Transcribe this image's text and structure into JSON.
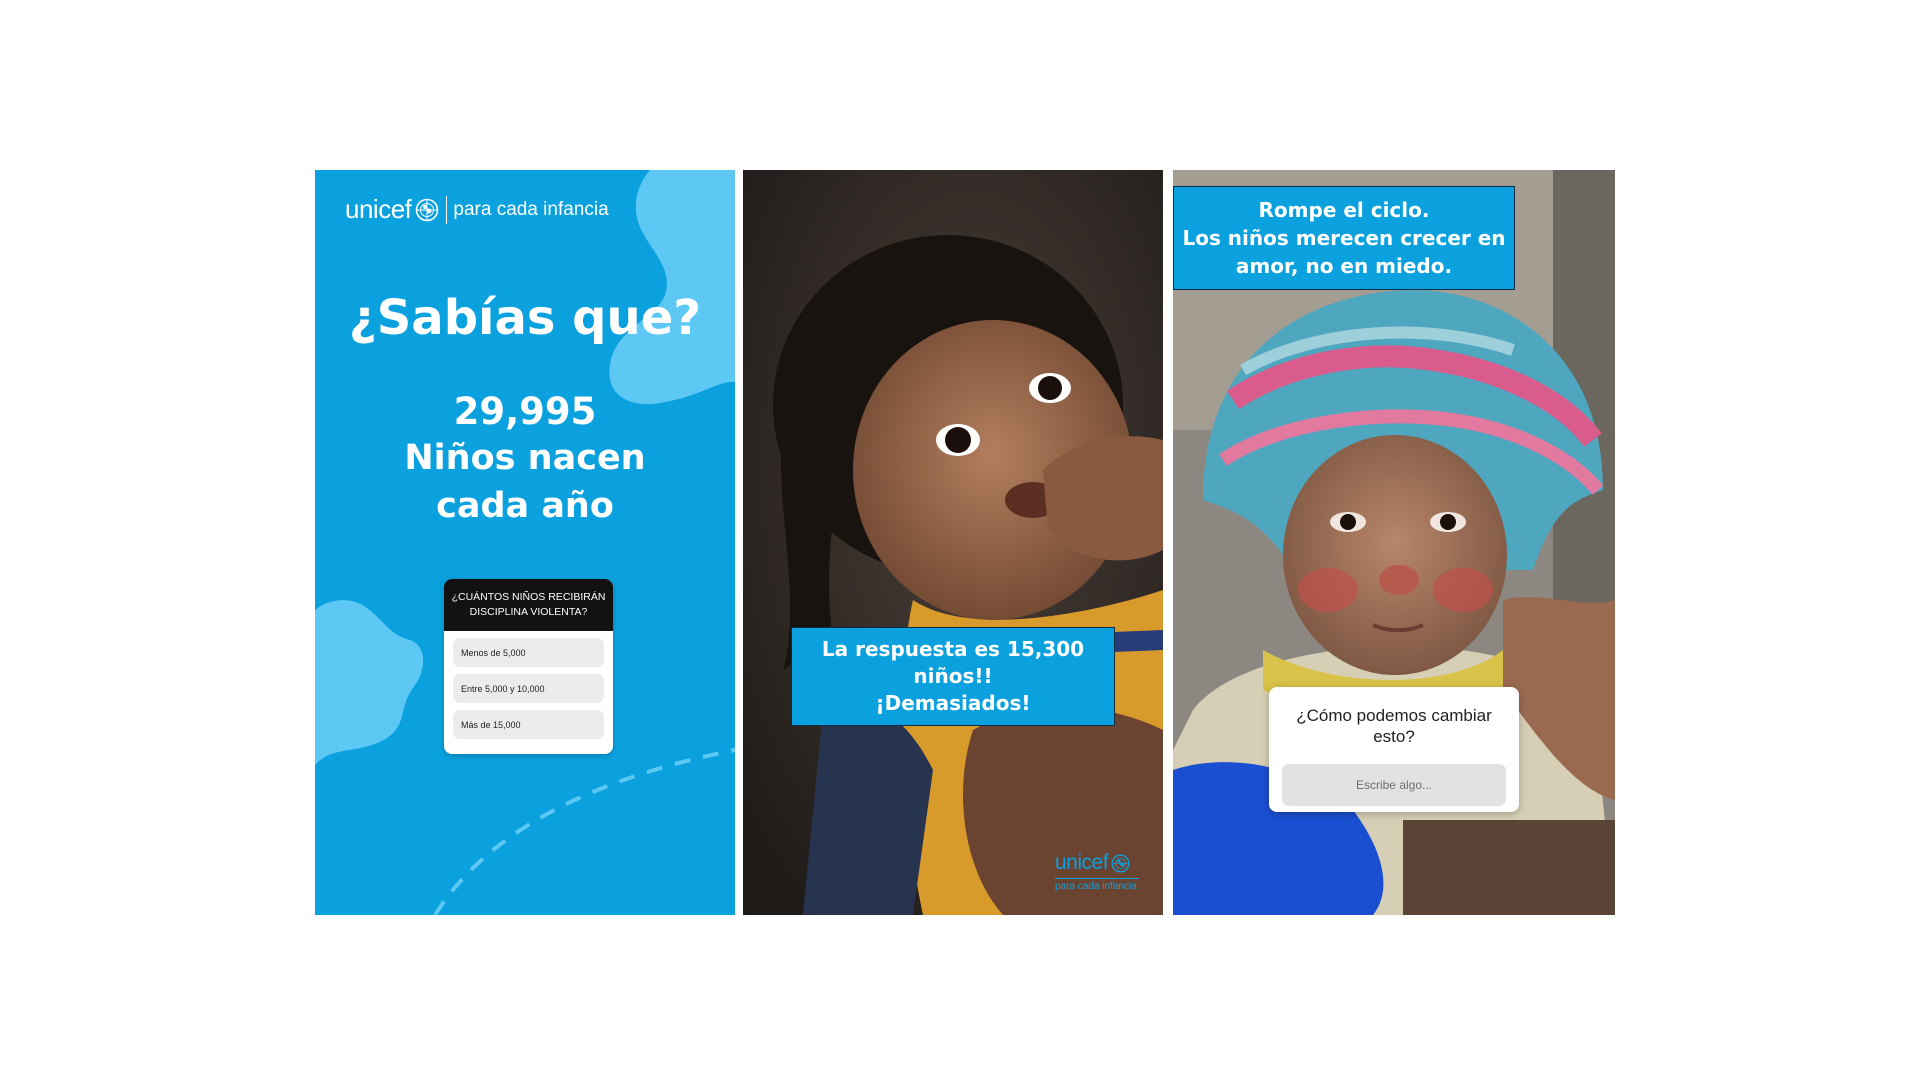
{
  "colors": {
    "brand_blue": "#0aa1de",
    "light_blue": "#5ec8f4",
    "quiz_header": "#121212",
    "page_bg": "#ffffff"
  },
  "panel1": {
    "logo_word": "unicef",
    "logo_icon": "unicef-globe-icon",
    "logo_tagline": "para cada infancia",
    "question": "¿Sabías que?",
    "number": "29,995",
    "line1": "Niños nacen",
    "line2": "cada año",
    "quiz": {
      "title_line1": "¿CUÁNTOS NIÑOS RECIBIRÁN",
      "title_line2": "DISCIPLINA VIOLENTA?",
      "options": [
        "Menos de 5,000",
        "Entre 5,000 y 10,000",
        "Más de 15,000"
      ]
    }
  },
  "panel2": {
    "answer_line1": "La respuesta es 15,300",
    "answer_line2": "niños!!",
    "answer_line3": "¡Demasiados!",
    "logo_word": "unicef",
    "logo_icon": "unicef-globe-icon",
    "logo_tagline": "para cada infancia"
  },
  "panel3": {
    "banner_line1": "Rompe el ciclo.",
    "banner_line2": "Los niños merecen crecer en",
    "banner_line3": "amor, no en miedo.",
    "question_line1": "¿Cómo podemos cambiar",
    "question_line2": "esto?",
    "input_placeholder": "Escribe algo..."
  }
}
